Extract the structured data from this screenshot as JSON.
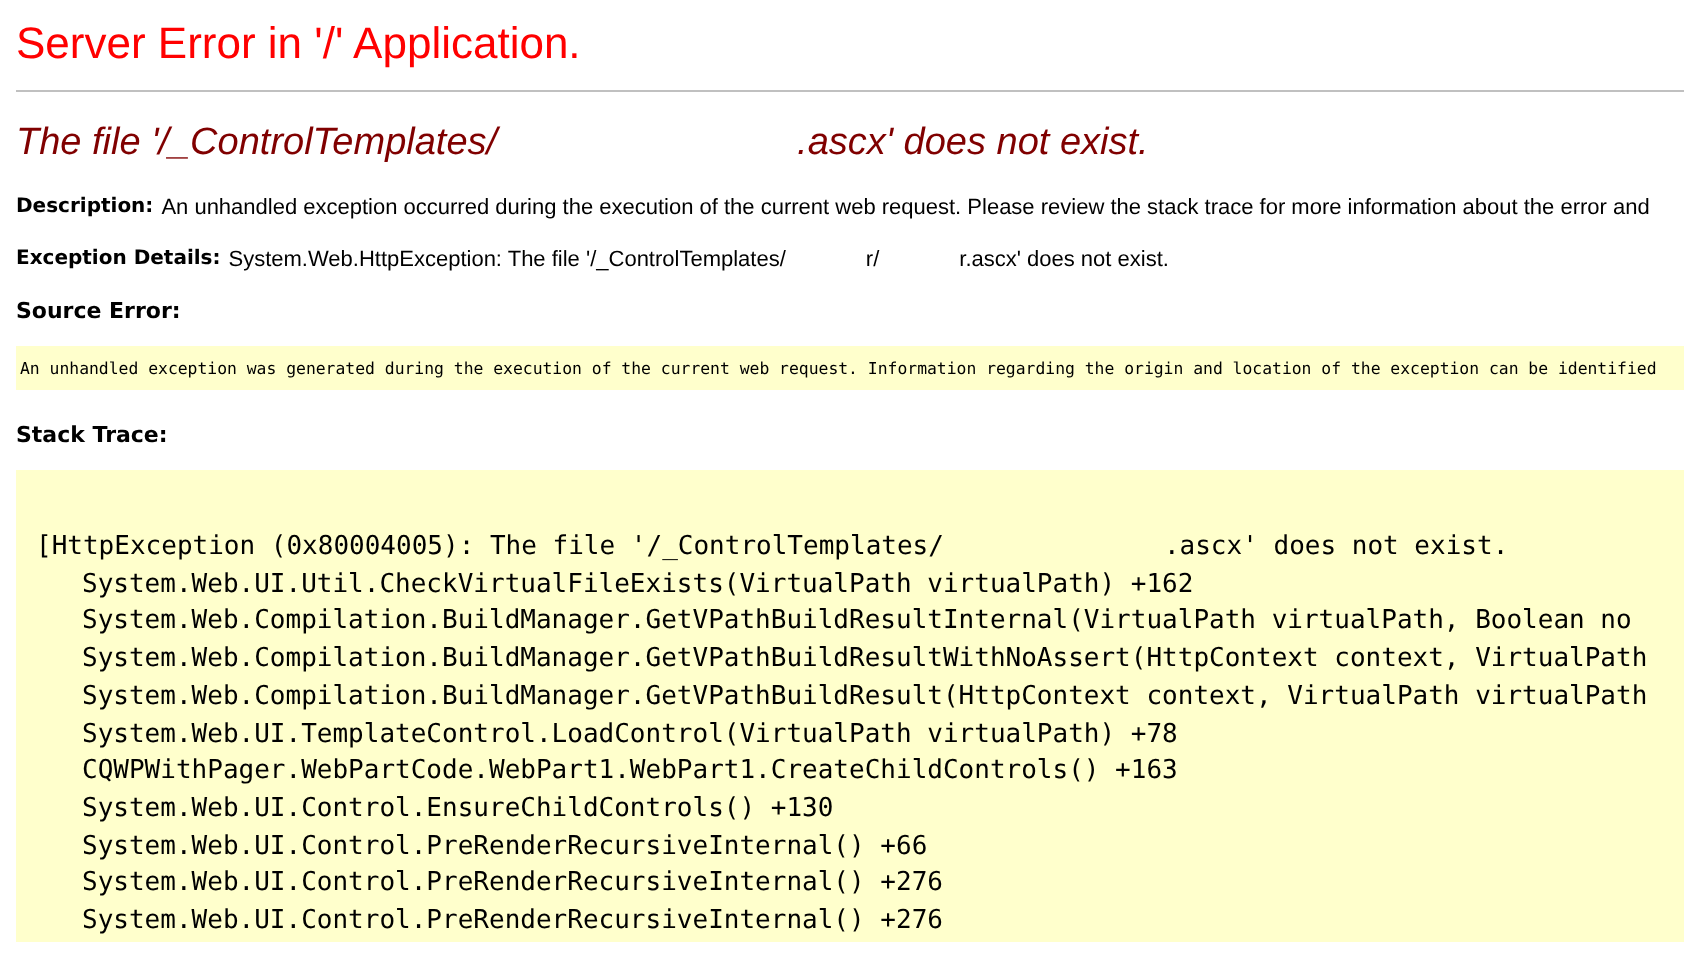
{
  "title": "Server Error in '/' Application.",
  "error_heading": {
    "parts": [
      "The file '/_ControlTemplates/",
      ".ascx' does not exist."
    ]
  },
  "description": {
    "label": "Description:",
    "text": "An unhandled exception occurred during the execution of the current web request. Please review the stack trace for more information about the error and"
  },
  "exception_details": {
    "label": "Exception Details:",
    "parts": [
      "System.Web.HttpException: The file '/_ControlTemplates/",
      "r/",
      "r.ascx' does not exist."
    ]
  },
  "source_error": {
    "label": "Source Error:",
    "text": "An unhandled exception was generated during the execution of the current web request. Information regarding the origin and location of the exception can be identified"
  },
  "stack_trace": {
    "label": "Stack Trace:",
    "header_parts": [
      "[HttpException (0x80004005): The file '/_ControlTemplates/",
      ".ascx' does not exist."
    ],
    "frames": [
      "System.Web.UI.Util.CheckVirtualFileExists(VirtualPath virtualPath) +162",
      "System.Web.Compilation.BuildManager.GetVPathBuildResultInternal(VirtualPath virtualPath, Boolean no",
      "System.Web.Compilation.BuildManager.GetVPathBuildResultWithNoAssert(HttpContext context, VirtualPath",
      "System.Web.Compilation.BuildManager.GetVPathBuildResult(HttpContext context, VirtualPath virtualPath",
      "System.Web.UI.TemplateControl.LoadControl(VirtualPath virtualPath) +78",
      "CQWPWithPager.WebPartCode.WebPart1.WebPart1.CreateChildControls() +163",
      "System.Web.UI.Control.EnsureChildControls() +130",
      "System.Web.UI.Control.PreRenderRecursiveInternal() +66",
      "System.Web.UI.Control.PreRenderRecursiveInternal() +276",
      "System.Web.UI.Control.PreRenderRecursiveInternal() +276"
    ]
  }
}
